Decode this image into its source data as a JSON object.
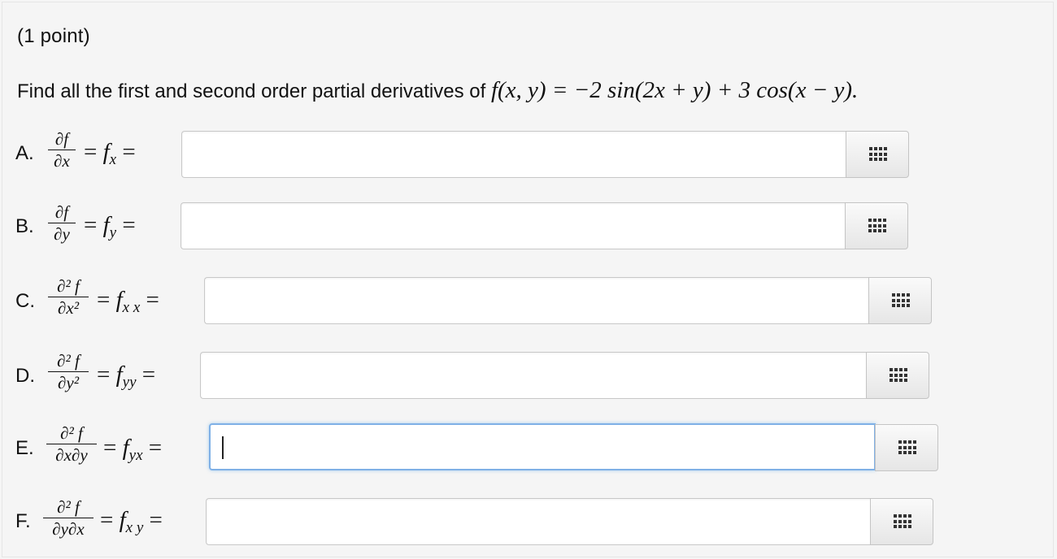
{
  "points": "(1 point)",
  "question": {
    "text": "Find all the first and second order partial derivatives of",
    "function": "f(x, y) = −2 sin(2x + y) + 3 cos(x − y)."
  },
  "parts": [
    {
      "label": "A.",
      "num": "∂f",
      "den": "∂x",
      "notation": "f",
      "sub": "x",
      "value": ""
    },
    {
      "label": "B.",
      "num": "∂f",
      "den": "∂y",
      "notation": "f",
      "sub": "y",
      "value": ""
    },
    {
      "label": "C.",
      "num": "∂² f",
      "den": "∂x²",
      "notation": "f",
      "sub": "x x",
      "value": ""
    },
    {
      "label": "D.",
      "num": "∂² f",
      "den": "∂y²",
      "notation": "f",
      "sub": "yy",
      "value": ""
    },
    {
      "label": "E.",
      "num": "∂² f",
      "den": "∂x∂y",
      "notation": "f",
      "sub": "yx",
      "value": ""
    },
    {
      "label": "F.",
      "num": "∂² f",
      "den": "∂y∂x",
      "notation": "f",
      "sub": "x y",
      "value": ""
    }
  ],
  "icon": "equation-editor-grid-icon"
}
